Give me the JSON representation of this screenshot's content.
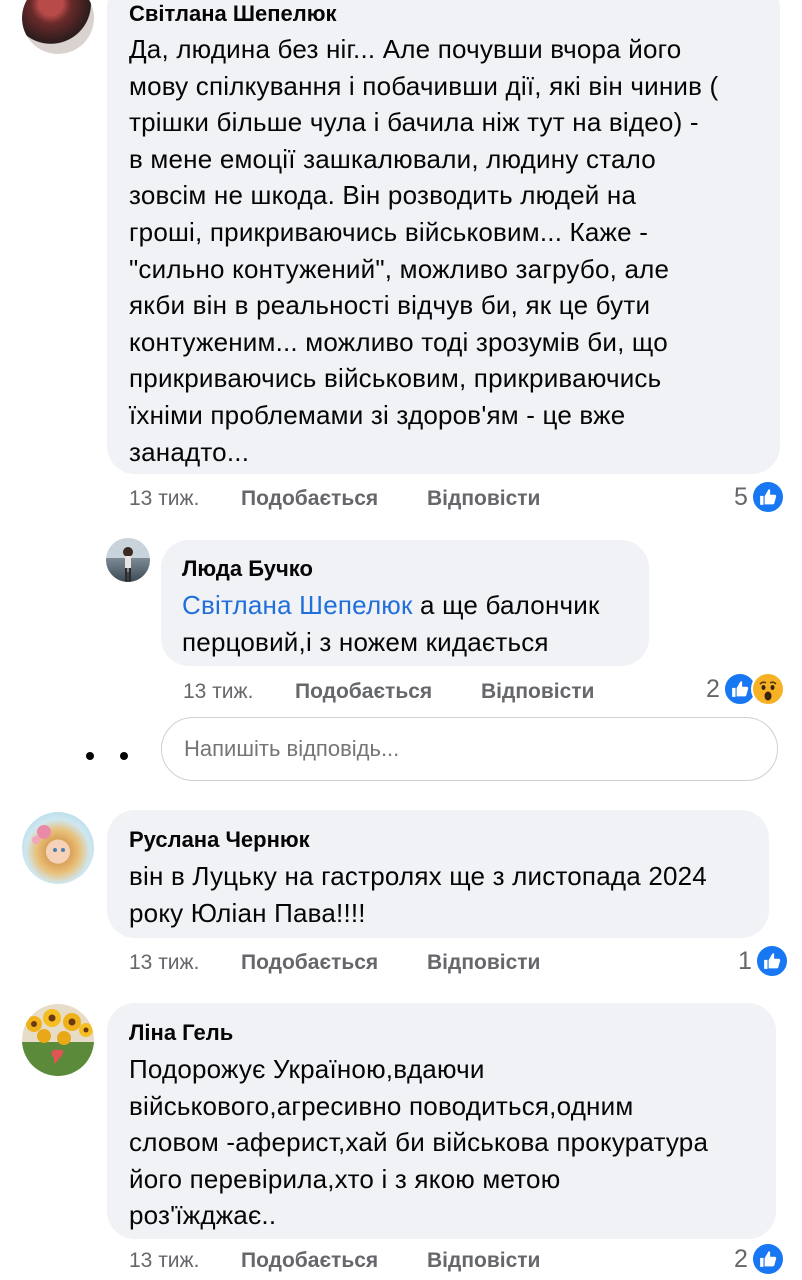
{
  "comments": [
    {
      "author": "Світлана Шепелюк",
      "lines": [
        "Да, людина без ніг... Але почувши вчора його",
        "мову спілкування і побачивши дії, які він чинив (",
        "трішки більше чула і бачила ніж тут на відео) -",
        "в мене емоції зашкалювали, людину стало",
        "зовсім не шкода. Він розводить людей на",
        "гроші, прикриваючись військовим... Каже -",
        "\"сильно контужений\", можливо загрубо, але",
        "якби він в реальності відчув би, як це бути",
        "контуженим... можливо тоді зрозумів би, що",
        "прикриваючись військовим, прикриваючись",
        "їхніми проблемами зі здоров'ям - це вже",
        "занадто..."
      ],
      "time": "13 тиж.",
      "like_label": "Подобається",
      "reply_label": "Відповісти",
      "reaction_count": "5"
    },
    {
      "author": "Люда Бучко",
      "mention": "Світлана Шепелюк",
      "line1_rest": " а ще балончик",
      "line2": "перцовий,і з ножем кидається",
      "time": "13 тиж.",
      "like_label": "Подобається",
      "reply_label": "Відповісти",
      "reaction_count": "2"
    },
    {
      "author": "Руслана Чернюк",
      "lines": [
        "він в Луцьку на гастролях ще з листопада 2024",
        "року Юліан Пава!!!!"
      ],
      "time": "13 тиж.",
      "like_label": "Подобається",
      "reply_label": "Відповісти",
      "reaction_count": "1"
    },
    {
      "author": "Ліна Гель",
      "lines": [
        "Подорожує Україною,вдаючи",
        "військового,агресивно поводиться,одним",
        "словом -аферист,хай би військова прокуратура",
        "його перевірила,хто і з якою метою",
        "роз'їжджає.."
      ],
      "time": "13 тиж.",
      "like_label": "Подобається",
      "reply_label": "Відповісти",
      "reaction_count": "2"
    }
  ],
  "reply_box": {
    "placeholder": "Напишіть відповідь..."
  },
  "colors": {
    "bubble": "#f0f2f5",
    "mention": "#216fdb",
    "meta": "#65676b",
    "like": "#1877f2"
  }
}
